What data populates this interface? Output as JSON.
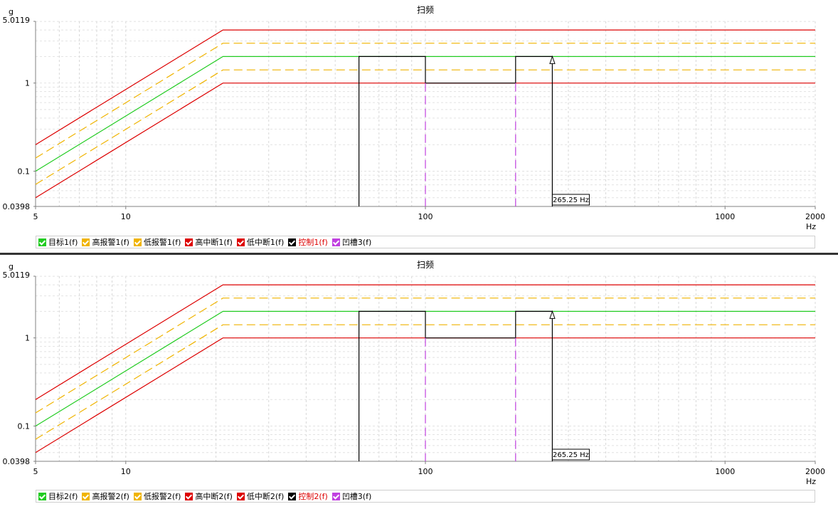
{
  "charts": [
    {
      "id": "p1",
      "title": "扫频",
      "y_unit": "g",
      "x_unit": "Hz",
      "y_ticks": [
        "5.0119",
        "1",
        "0.1",
        "0.0398"
      ],
      "x_ticks": [
        "5",
        "10",
        "100",
        "1000",
        "2000"
      ],
      "cursor_label": "265.25 Hz",
      "legend": [
        {
          "label": "目标1(f)",
          "color": "#22cc22",
          "text_color": "#000000"
        },
        {
          "label": "高报警1(f)",
          "color": "#f0b400",
          "text_color": "#000000"
        },
        {
          "label": "低报警1(f)",
          "color": "#f0b400",
          "text_color": "#000000"
        },
        {
          "label": "高中断1(f)",
          "color": "#dd0000",
          "text_color": "#000000"
        },
        {
          "label": "低中断1(f)",
          "color": "#dd0000",
          "text_color": "#000000"
        },
        {
          "label": "控制1(f)",
          "color": "#000000",
          "text_color": "#dd0000"
        },
        {
          "label": "凹槽3(f)",
          "color": "#c040e0",
          "text_color": "#000000"
        }
      ]
    },
    {
      "id": "p2",
      "title": "扫频",
      "y_unit": "g",
      "x_unit": "Hz",
      "y_ticks": [
        "5.0119",
        "1",
        "0.1",
        "0.0398"
      ],
      "x_ticks": [
        "5",
        "10",
        "100",
        "1000",
        "2000"
      ],
      "cursor_label": "265.25 Hz",
      "legend": [
        {
          "label": "目标2(f)",
          "color": "#22cc22",
          "text_color": "#000000"
        },
        {
          "label": "高报警2(f)",
          "color": "#f0b400",
          "text_color": "#000000"
        },
        {
          "label": "低报警2(f)",
          "color": "#f0b400",
          "text_color": "#000000"
        },
        {
          "label": "高中断2(f)",
          "color": "#dd0000",
          "text_color": "#000000"
        },
        {
          "label": "低中断2(f)",
          "color": "#dd0000",
          "text_color": "#000000"
        },
        {
          "label": "控制2(f)",
          "color": "#000000",
          "text_color": "#dd0000"
        },
        {
          "label": "凹槽3(f)",
          "color": "#c040e0",
          "text_color": "#000000"
        }
      ]
    }
  ],
  "chart_data": [
    {
      "type": "line",
      "title": "扫频",
      "xscale": "log",
      "yscale": "log",
      "xlim": [
        5,
        2000
      ],
      "ylim": [
        0.0398,
        5.0119
      ],
      "xlabel": "Hz",
      "ylabel": "g",
      "grid": true,
      "legend_position": "bottom",
      "series": [
        {
          "name": "目标1(f)",
          "style": "solid",
          "color": "#22cc22",
          "x": [
            5,
            21.1,
            2000
          ],
          "y": [
            0.1,
            2,
            2
          ]
        },
        {
          "name": "高报警1(f)",
          "style": "dashed",
          "color": "#f0b400",
          "x": [
            5,
            21.1,
            2000
          ],
          "y": [
            0.141,
            2.83,
            2.83
          ]
        },
        {
          "name": "低报警1(f)",
          "style": "dashed",
          "color": "#f0b400",
          "x": [
            5,
            21.1,
            2000
          ],
          "y": [
            0.0708,
            1.41,
            1.41
          ]
        },
        {
          "name": "高中断1(f)",
          "style": "solid",
          "color": "#dd0000",
          "x": [
            5,
            21.1,
            2000
          ],
          "y": [
            0.2,
            4,
            4
          ]
        },
        {
          "name": "低中断1(f)",
          "style": "solid",
          "color": "#dd0000",
          "x": [
            5,
            21.1,
            2000
          ],
          "y": [
            0.05,
            1,
            1
          ]
        },
        {
          "name": "控制1(f)",
          "style": "solid",
          "color": "#000000",
          "x": [
            60,
            60,
            100,
            100,
            200,
            200,
            265.25,
            265.25
          ],
          "y": [
            0.0398,
            2,
            2,
            1,
            1,
            2,
            2,
            0.0398
          ]
        },
        {
          "name": "凹槽3(f)",
          "style": "dashed",
          "color": "#c040e0",
          "x_vlines": [
            100,
            200
          ]
        }
      ],
      "cursor_x": 265.25
    },
    {
      "type": "line",
      "title": "扫频",
      "xscale": "log",
      "yscale": "log",
      "xlim": [
        5,
        2000
      ],
      "ylim": [
        0.0398,
        5.0119
      ],
      "xlabel": "Hz",
      "ylabel": "g",
      "grid": true,
      "legend_position": "bottom",
      "series": [
        {
          "name": "目标2(f)",
          "style": "solid",
          "color": "#22cc22",
          "x": [
            5,
            21.1,
            2000
          ],
          "y": [
            0.1,
            2,
            2
          ]
        },
        {
          "name": "高报警2(f)",
          "style": "dashed",
          "color": "#f0b400",
          "x": [
            5,
            21.1,
            2000
          ],
          "y": [
            0.141,
            2.83,
            2.83
          ]
        },
        {
          "name": "低报警2(f)",
          "style": "dashed",
          "color": "#f0b400",
          "x": [
            5,
            21.1,
            2000
          ],
          "y": [
            0.0708,
            1.41,
            1.41
          ]
        },
        {
          "name": "高中断2(f)",
          "style": "solid",
          "color": "#dd0000",
          "x": [
            5,
            21.1,
            2000
          ],
          "y": [
            0.2,
            4,
            4
          ]
        },
        {
          "name": "低中断2(f)",
          "style": "solid",
          "color": "#dd0000",
          "x": [
            5,
            21.1,
            2000
          ],
          "y": [
            0.05,
            1,
            1
          ]
        },
        {
          "name": "控制2(f)",
          "style": "solid",
          "color": "#000000",
          "x": [
            60,
            60,
            100,
            100,
            200,
            200,
            265.25,
            265.25
          ],
          "y": [
            0.0398,
            2,
            2,
            1,
            1,
            2,
            2,
            0.0398
          ]
        },
        {
          "name": "凹槽3(f)",
          "style": "dashed",
          "color": "#c040e0",
          "x_vlines": [
            100,
            200
          ]
        }
      ],
      "cursor_x": 265.25
    }
  ]
}
